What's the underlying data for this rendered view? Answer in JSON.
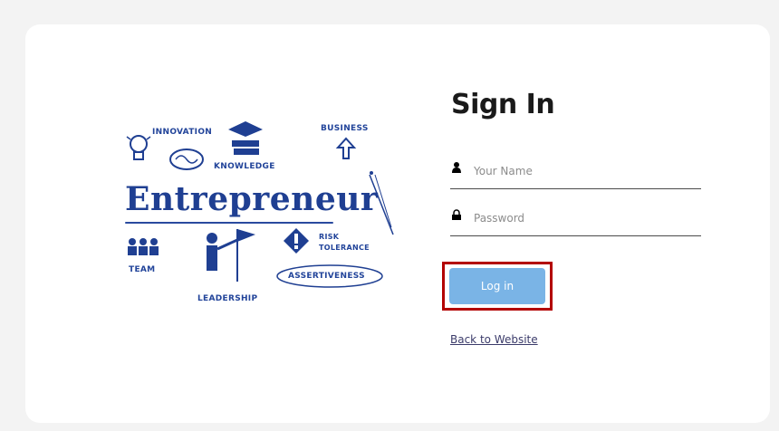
{
  "illustration": {
    "main_word": "Entrepreneur",
    "labels": {
      "innovation": "INNOVATION",
      "knowledge": "KNOWLEDGE",
      "business": "BUSINESS",
      "team": "TEAM",
      "risk": "RISK",
      "tolerance": "TOLERANCE",
      "leadership": "LEADERSHIP",
      "assertiveness": "ASSERTIVENESS"
    }
  },
  "form": {
    "title": "Sign In",
    "name_placeholder": "Your Name",
    "password_placeholder": "Password",
    "login_label": "Log in",
    "back_link": "Back to Website"
  },
  "colors": {
    "accent": "#7ab4e6",
    "highlight_border": "#b30000",
    "illustration": "#1f3f92"
  }
}
